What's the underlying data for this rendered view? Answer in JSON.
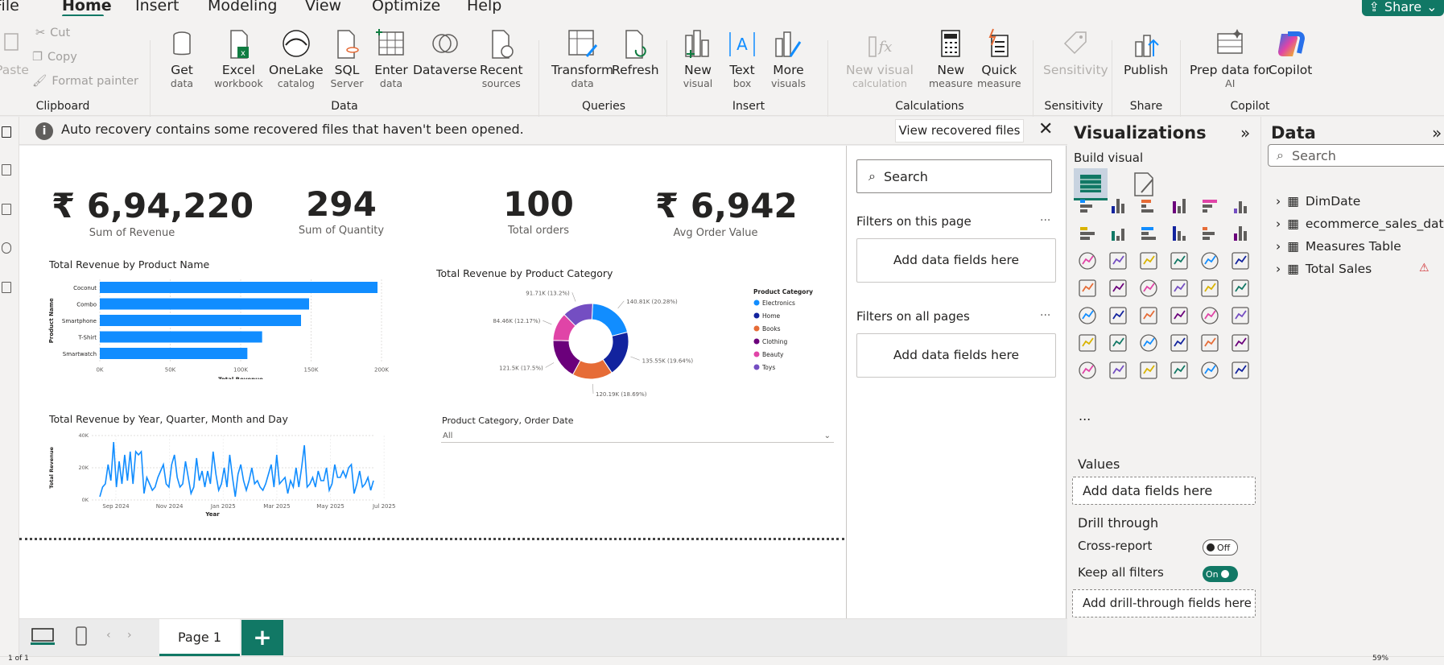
{
  "menu": {
    "items": [
      "File",
      "Home",
      "Insert",
      "Modeling",
      "View",
      "Optimize",
      "Help"
    ],
    "share_label": "Share"
  },
  "ribbon": {
    "clipboard": {
      "paste": "Paste",
      "cut": "Cut",
      "copy": "Copy",
      "format_painter": "Format painter",
      "group": "Clipboard"
    },
    "data": {
      "get": "Get",
      "get_sub": "data",
      "excel": "Excel",
      "excel_sub": "workbook",
      "onelake": "OneLake",
      "onelake_sub": "catalog",
      "sql": "SQL",
      "sql_sub": "Server",
      "enter": "Enter",
      "enter_sub": "data",
      "dataverse": "Dataverse",
      "recent": "Recent",
      "recent_sub": "sources",
      "group": "Data"
    },
    "queries": {
      "transform": "Transform",
      "transform_sub": "data",
      "refresh": "Refresh",
      "group": "Queries"
    },
    "insert": {
      "new_visual": "New",
      "new_visual_sub": "visual",
      "text_box": "Text",
      "text_box_sub": "box",
      "more": "More",
      "more_sub": "visuals",
      "group": "Insert"
    },
    "calculations": {
      "new_visual_calc": "New visual",
      "new_visual_calc_sub": "calculation",
      "new_measure": "New",
      "new_measure_sub": "measure",
      "quick": "Quick",
      "quick_sub": "measure",
      "group": "Calculations"
    },
    "sensitivity": {
      "label": "Sensitivity",
      "group": "Sensitivity"
    },
    "share": {
      "publish": "Publish",
      "group": "Share"
    },
    "copilot": {
      "prep": "Prep data for",
      "prep_sub": "AI",
      "copilot": "Copilot",
      "group": "Copilot"
    }
  },
  "notification": {
    "text": "Auto recovery contains some recovered files that haven't been opened.",
    "button": "View recovered files"
  },
  "kpis": [
    {
      "value": "₹ 6,94,220",
      "label": "Sum of Revenue"
    },
    {
      "value": "294",
      "label": "Sum of Quantity"
    },
    {
      "value": "100",
      "label": "Total orders"
    },
    {
      "value": "₹ 6,942",
      "label": "Avg Order Value"
    }
  ],
  "chart_data": [
    {
      "type": "bar",
      "title": "Total Revenue by Product Name",
      "ylabel": "Product Name",
      "xlabel": "Total Revenue",
      "categories": [
        "Coconut",
        "Combo",
        "Smartphone",
        "T-Shirt",
        "Smartwatch"
      ],
      "values": [
        207,
        156,
        150,
        121,
        110
      ],
      "xlim": [
        0,
        210
      ],
      "xticks": [
        "0K",
        "50K",
        "100K",
        "150K",
        "200K"
      ],
      "color": "#118dff"
    },
    {
      "type": "pie",
      "title": "Total Revenue by Product Category",
      "legend_title": "Product Category",
      "legend_position": "right",
      "slices": [
        {
          "name": "Electronics",
          "value": 140.81,
          "label": "140.81K (20.28%)",
          "color": "#118dff"
        },
        {
          "name": "Home",
          "value": 135.55,
          "label": "135.55K (19.64%)",
          "color": "#12239e"
        },
        {
          "name": "Books",
          "value": 120.19,
          "label": "120.19K (18.69%)",
          "color": "#e66c37"
        },
        {
          "name": "Clothing",
          "value": 121.5,
          "label": "121.5K (17.5%)",
          "color": "#6b007b"
        },
        {
          "name": "Beauty",
          "value": 84.46,
          "label": "84.46K (12.17%)",
          "color": "#e044a7"
        },
        {
          "name": "Toys",
          "value": 91.71,
          "label": "91.71K (13.2%)",
          "color": "#744ec2"
        }
      ]
    },
    {
      "type": "line",
      "title": "Total Revenue by Year, Quarter, Month and Day",
      "xlabel": "Year",
      "ylabel": "Total Revenue",
      "ylim": [
        0,
        40
      ],
      "yticks": [
        "0K",
        "20K",
        "40K"
      ],
      "xticks": [
        "Sep 2024",
        "Nov 2024",
        "Jan 2025",
        "Mar 2025",
        "May 2025",
        "Jul 2025"
      ],
      "values": [
        2,
        8,
        10,
        22,
        12,
        36,
        8,
        24,
        10,
        28,
        12,
        30,
        10,
        30,
        28,
        30,
        4,
        14,
        10,
        6,
        8,
        14,
        18,
        22,
        10,
        8,
        22,
        28,
        14,
        8,
        10,
        24,
        14,
        4,
        8,
        26,
        12,
        18,
        8,
        18,
        10,
        30,
        16,
        6,
        10,
        20,
        8,
        28,
        14,
        2,
        16,
        22,
        12,
        6,
        12,
        20,
        10,
        12,
        8,
        6,
        10,
        16,
        22,
        8,
        28,
        10,
        12,
        14,
        4,
        12,
        8,
        20,
        8,
        20,
        34,
        8,
        10,
        14,
        8,
        18,
        12,
        12,
        20,
        6,
        10,
        22,
        14,
        14,
        18,
        14,
        20,
        22,
        4,
        10,
        18,
        8,
        10,
        14,
        6,
        12
      ],
      "color": "#118dff"
    }
  ],
  "slicer": {
    "title": "Product Category, Order Date",
    "value": "All"
  },
  "filters": {
    "search": "Search",
    "on_page": "Filters on this page",
    "on_all": "Filters on all pages",
    "add_fields": "Add data fields here"
  },
  "visualizations": {
    "title": "Visualizations",
    "build": "Build visual",
    "more": "...",
    "values": "Values",
    "add_fields": "Add data fields here",
    "drill": "Drill through",
    "cross": "Cross-report",
    "cross_state": "Off",
    "keep": "Keep all filters",
    "keep_state": "On",
    "add_drill": "Add drill-through fields here"
  },
  "data": {
    "title": "Data",
    "search": "Search",
    "items": [
      "DimDate",
      "ecommerce_sales_data",
      "Measures Table",
      "Total Sales"
    ]
  },
  "pages": {
    "tab": "Page 1",
    "add": "+"
  },
  "status": {
    "page": "1 of 1",
    "zoom": "59%"
  },
  "colors": {
    "accent": "#117865",
    "chart_blue": "#118dff",
    "warning": "#d13438"
  }
}
